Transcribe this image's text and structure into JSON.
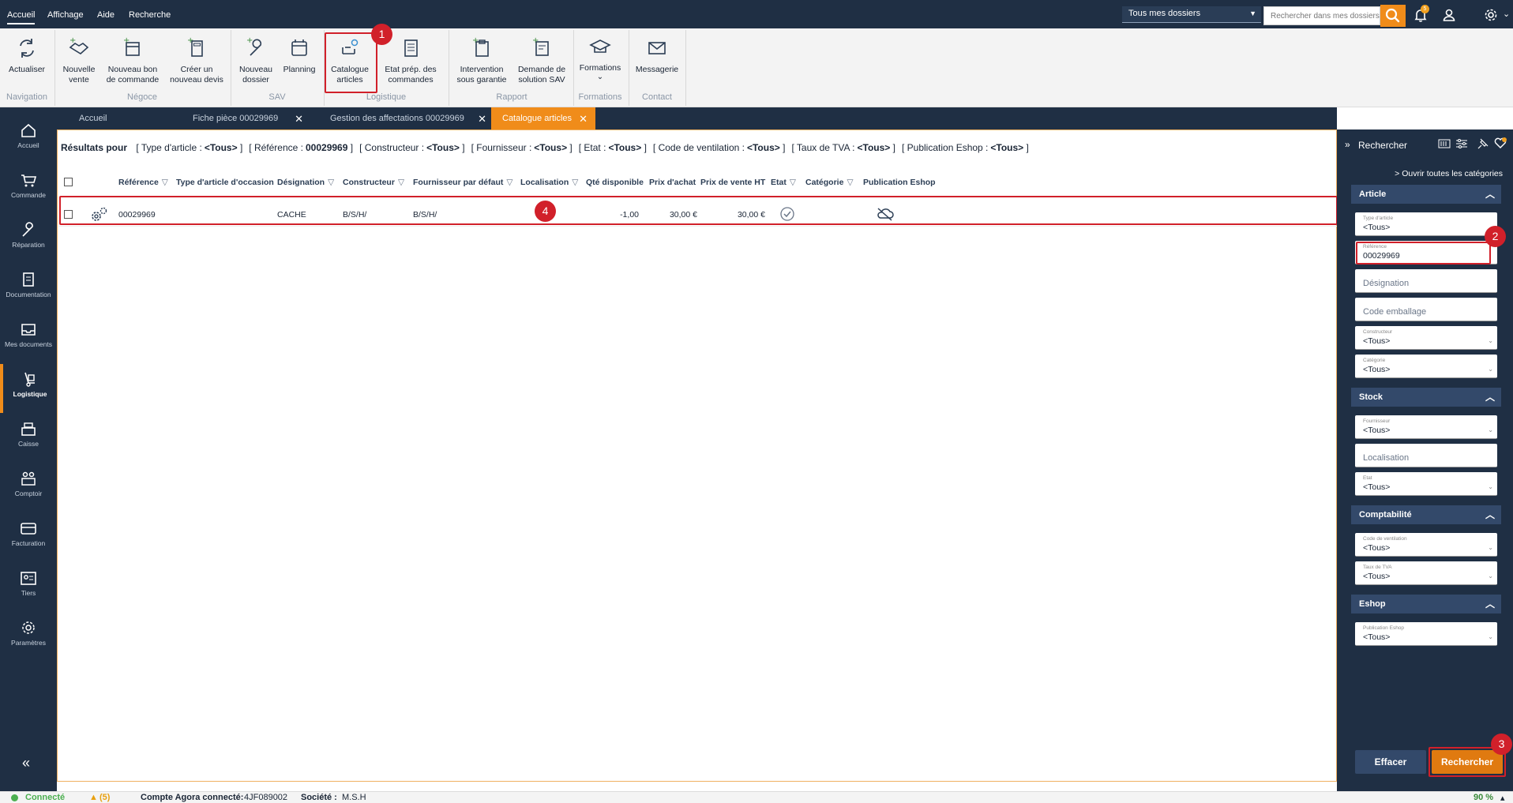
{
  "menu": {
    "items": [
      "Accueil",
      "Affichage",
      "Aide",
      "Recherche"
    ],
    "active": "Accueil"
  },
  "top": {
    "dossier_select": "Tous mes dossiers",
    "search_placeholder": "Rechercher dans mes dossiers",
    "notification_count": "5",
    "accent_color": "#f08c1a"
  },
  "ribbon": {
    "buttons": {
      "actualiser": "Actualiser",
      "nouvelle_vente": "Nouvelle vente",
      "nouveau_bon": "Nouveau bon de commande",
      "creer_devis": "Créer un nouveau devis",
      "nouveau_dossier": "Nouveau dossier",
      "planning": "Planning",
      "catalogue": "Catalogue articles",
      "etat_prep": "Etat prép. des commandes",
      "intervention": "Intervention sous garantie",
      "demande_sav": "Demande de solution SAV",
      "formations": "Formations",
      "messagerie": "Messagerie"
    },
    "groups": {
      "navigation": "Navigation",
      "negoce": "Négoce",
      "sav": "SAV",
      "logistique": "Logistique",
      "rapport": "Rapport",
      "formations": "Formations",
      "contact": "Contact"
    }
  },
  "sidebar": {
    "items": [
      "Accueil",
      "Commande",
      "Réparation",
      "Documentation",
      "Mes documents",
      "Logistique",
      "Caisse",
      "Comptoir",
      "Facturation",
      "Tiers",
      "Paramètres"
    ],
    "active": "Logistique",
    "collapse": "«"
  },
  "tabs": [
    {
      "label": "Accueil",
      "closable": false
    },
    {
      "label": "Fiche pièce 00029969",
      "closable": true
    },
    {
      "label": "Gestion des affectations 00029969",
      "closable": true
    },
    {
      "label": "Catalogue articles",
      "closable": true,
      "active": true
    }
  ],
  "results": {
    "heading": "Résultats pour",
    "filters": [
      {
        "name": "Type d'article :",
        "value": "<Tous>"
      },
      {
        "name": "Référence :",
        "value": "00029969"
      },
      {
        "name": "Constructeur :",
        "value": "<Tous>"
      },
      {
        "name": "Fournisseur :",
        "value": "<Tous>"
      },
      {
        "name": "Etat :",
        "value": "<Tous>"
      },
      {
        "name": "Code de ventilation :",
        "value": "<Tous>"
      },
      {
        "name": "Taux de TVA :",
        "value": "<Tous>"
      },
      {
        "name": "Publication Eshop :",
        "value": "<Tous>"
      }
    ],
    "columns": {
      "reference": "Référence",
      "type_occasion": "Type d'article d'occasion",
      "designation": "Désignation",
      "constructeur": "Constructeur",
      "fournisseur": "Fournisseur par défaut",
      "localisation": "Localisation",
      "qte": "Qté disponible",
      "prix_achat": "Prix d'achat",
      "prix_vente": "Prix de vente HT",
      "etat": "Etat",
      "categorie": "Catégorie",
      "eshop": "Publication Eshop"
    },
    "row": {
      "reference": "00029969",
      "designation": "CACHE",
      "constructeur": "B/S/H/",
      "fournisseur": "B/S/H/",
      "qte": "-1,00",
      "prix_achat": "30,00 €",
      "prix_vente": "30,00 €"
    }
  },
  "search_panel": {
    "title": "Rechercher",
    "open_all": "Ouvrir toutes les catégories",
    "sections": {
      "article": "Article",
      "stock": "Stock",
      "comptabilite": "Comptabilité",
      "eshop": "Eshop"
    },
    "fields": {
      "type_article": {
        "label": "Type d'article",
        "value": "<Tous>"
      },
      "reference": {
        "label": "Référence",
        "value": "00029969"
      },
      "designation": {
        "placeholder": "Désignation"
      },
      "code_emballage": {
        "placeholder": "Code emballage"
      },
      "constructeur": {
        "label": "Constructeur",
        "value": "<Tous>"
      },
      "categorie": {
        "label": "Catégorie",
        "value": "<Tous>"
      },
      "fournisseur": {
        "label": "Fournisseur",
        "value": "<Tous>"
      },
      "localisation": {
        "placeholder": "Localisation"
      },
      "etat": {
        "label": "Etat",
        "value": "<Tous>"
      },
      "code_ventilation": {
        "label": "Code de ventilation",
        "value": "<Tous>"
      },
      "taux_tva": {
        "label": "Taux de TVA",
        "value": "<Tous>"
      },
      "publication_eshop": {
        "label": "Publication Eshop",
        "value": "<Tous>"
      }
    },
    "buttons": {
      "effacer": "Effacer",
      "rechercher": "Rechercher"
    }
  },
  "annotations": [
    "1",
    "2",
    "3",
    "4"
  ],
  "status": {
    "connected": "Connecté",
    "warnings": "(5)",
    "account_label": "Compte Agora connecté:",
    "account_value": "4JF089002",
    "company_label": "Société :",
    "company_value": "M.S.H",
    "zoom": "90 %"
  }
}
